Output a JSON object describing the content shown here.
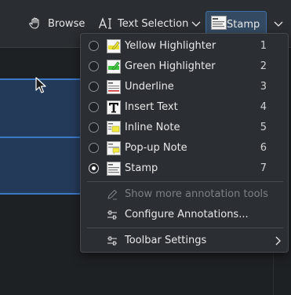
{
  "toolbar": {
    "browse_label": "Browse",
    "text_selection_label": "Text Selection",
    "stamp_label": "Stamp"
  },
  "menu": {
    "tools": [
      {
        "label": "Yellow Highlighter",
        "shortcut": "1",
        "icon": "yellow-highlighter-icon",
        "checked": false
      },
      {
        "label": "Green Highlighter",
        "shortcut": "2",
        "icon": "green-highlighter-icon",
        "checked": false
      },
      {
        "label": "Underline",
        "shortcut": "3",
        "icon": "underline-icon",
        "checked": false
      },
      {
        "label": "Insert Text",
        "shortcut": "4",
        "icon": "insert-text-icon",
        "checked": false
      },
      {
        "label": "Inline Note",
        "shortcut": "5",
        "icon": "inline-note-icon",
        "checked": false
      },
      {
        "label": "Pop-up Note",
        "shortcut": "6",
        "icon": "popup-note-icon",
        "checked": false
      },
      {
        "label": "Stamp",
        "shortcut": "7",
        "icon": "stamp-icon",
        "checked": true
      }
    ],
    "show_more_label": "Show more annotation tools",
    "configure_label": "Configure Annotations...",
    "toolbar_settings_label": "Toolbar Settings"
  },
  "colors": {
    "accent": "#3d6fa5",
    "menu_bg": "#2b2e32",
    "toolbar_bg": "#2a2d31",
    "selection_blue": "#3a78c8"
  }
}
